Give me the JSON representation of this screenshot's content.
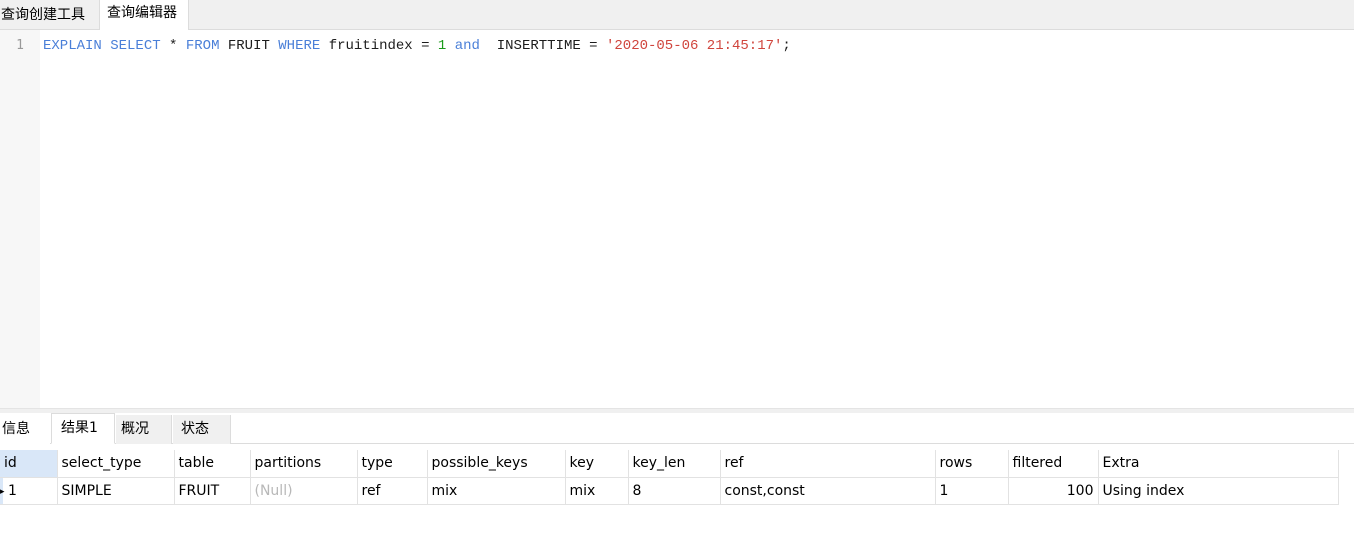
{
  "top_tabs": [
    {
      "label": "查询创建工具"
    },
    {
      "label": "查询编辑器"
    }
  ],
  "editor": {
    "line_number": "1",
    "tokens": {
      "explain": "EXPLAIN",
      "select": "SELECT",
      "star": " * ",
      "from": "FROM",
      "table": " FRUIT ",
      "where": "WHERE",
      "cond1": " fruitindex = ",
      "num": "1",
      "and": "and",
      "cond2": "  INSERTTIME = ",
      "str": "'2020-05-06 21:45:17'",
      "end": ";"
    }
  },
  "result_tabs": [
    {
      "label": "信息"
    },
    {
      "label": "结果1"
    },
    {
      "label": "概况"
    },
    {
      "label": "状态"
    }
  ],
  "grid": {
    "columns": [
      "id",
      "select_type",
      "table",
      "partitions",
      "type",
      "possible_keys",
      "key",
      "key_len",
      "ref",
      "rows",
      "filtered",
      "Extra"
    ],
    "row": {
      "id": "1",
      "select_type": "SIMPLE",
      "table": "FRUIT",
      "partitions": "(Null)",
      "type": "ref",
      "possible_keys": "mix",
      "key": "mix",
      "key_len": "8",
      "ref": "const,const",
      "rows": "1",
      "filtered": "100",
      "Extra": "Using index"
    },
    "row_marker": "▸"
  },
  "colors": {
    "keyword": "#4a7fd8",
    "number": "#1a9a1a",
    "string": "#d0453d",
    "selected_header": "#d9e7f8"
  }
}
